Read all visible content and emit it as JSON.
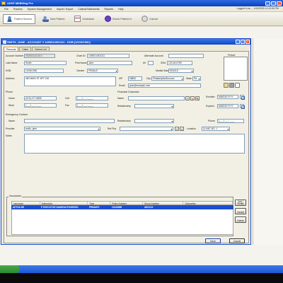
{
  "window": {
    "title": "ADS® MDBilling Pro"
  },
  "menu": {
    "items": [
      "File",
      "Practice",
      "System Management",
      "Import / Export",
      "Claims/Statements",
      "Reports",
      "Help"
    ],
    "logged_in": "Logged in as ... 4/19/2005 10:19:56 PM"
  },
  "toolbar": {
    "buttons": [
      "Patient Search",
      "New Patient",
      "Scheduler",
      "Check Patient In",
      "Cancel"
    ]
  },
  "dialog": {
    "title": "SMITH, JANE - ACCOUNT # 1490014001111 - DOB [10/15/1981]",
    "tabs": [
      "Personal",
      "Claim",
      "Claims List"
    ]
  },
  "form": {
    "account_number_label": "Account Number",
    "account_number": "0000001101010",
    "chart_id_label": "Chart ID",
    "chart_id": "1490014001111",
    "alternate_account_label": "Alternate Account",
    "alternate_account": "",
    "last_name_label": "Last Name",
    "last_name": "Smith",
    "first_name_label": "First Name",
    "first_name": "Jane",
    "mi_label": "MI",
    "mi": "",
    "dob_label": "DOB",
    "dob": "10/15/1981",
    "ssn_label": "SSN",
    "ssn": "123-45-6789",
    "gender_label": "Gender",
    "gender": "FEMALE",
    "marital_label": "Marital Status",
    "marital": "SINGLE",
    "address_label": "Address",
    "address": "460 MAIN ST APT 100",
    "zip_label": "ZIP",
    "zip": "08820",
    "city_label": "City",
    "city": "Philadelphia/Dumont",
    "state_label": "State",
    "state": "PA",
    "email_label": "Email",
    "email": "jane@example.com",
    "phone_section": "Phone",
    "home_label": "Home",
    "home": "(215) 477-5555",
    "cell_label": "Cell",
    "cell": "(___) ___-____",
    "work_label": "Work",
    "work": "(___) ___-____",
    "fax_label": "Fax",
    "fax": "(___) ___-____",
    "financial_guarantor_label": "Financial Guarantor",
    "name_label": "Name",
    "name": "",
    "relationship_label": "Relationship",
    "relationship": "",
    "enrolled_label": "Enrolled",
    "enrolled": "MM/DD/YYYY",
    "expired_label": "Expired",
    "expired": "MM/DD/YYYY",
    "emergency_label": "Emergency Contact",
    "em_name_label": "Name",
    "em_name": "",
    "em_relationship_label": "Relationship",
    "em_relationship": "",
    "em_phone_label": "Phone",
    "em_phone": "(___) ___-____",
    "provider_label": "Provider",
    "provider": "smith, jane",
    "ref_phy_label": "Ref Phy",
    "ref_phy": "",
    "location_label": "Location",
    "location": "CLINIC NO. 1",
    "notes_label": "Notes",
    "notes": "",
    "photo_label": "Picture"
  },
  "insurance": {
    "section_label": "Insurances",
    "columns": [
      "Insurance",
      "Authorized",
      "Type",
      "Policy Number",
      "Group Number",
      "Subscriber"
    ],
    "rows": [
      [
        "AETNA NE",
        "P EXECUTOR NAME/AUTHORIZED",
        "PRIMARY",
        "12345688",
        "ABC123",
        ""
      ]
    ],
    "add_label": "Add / Modify",
    "cancel_label": "Cancel",
    "delete_label": "Delete"
  },
  "buttons": {
    "save": "Save",
    "cancel": "Cancel"
  },
  "colors": {
    "titlebar": "#0a3fc0",
    "selection": "#1c4fd0",
    "panel": "#ece9d8"
  }
}
